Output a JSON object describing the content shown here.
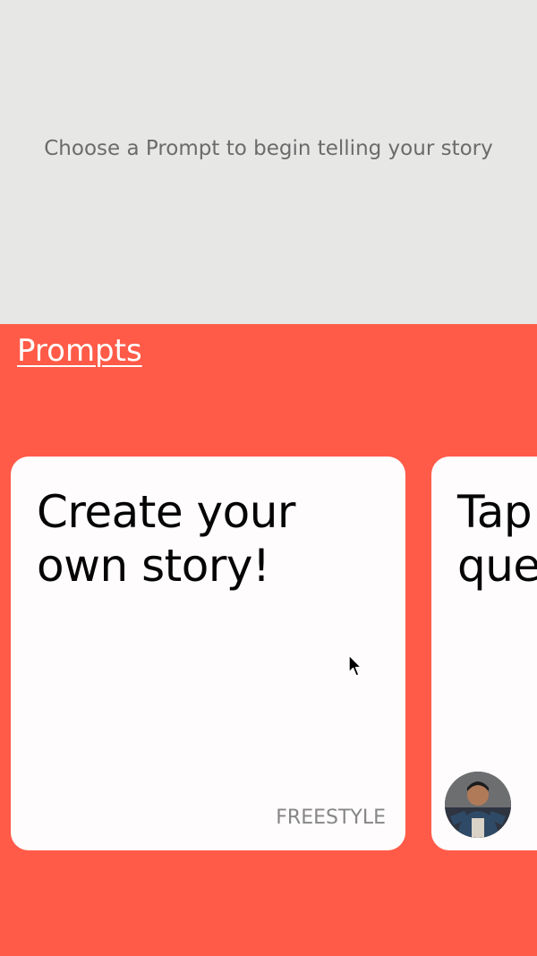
{
  "top": {
    "hint": "Choose a Prompt to begin telling your story"
  },
  "prompts": {
    "heading": "Prompts",
    "cards": [
      {
        "title": "Create your own story!",
        "tag": "FREESTYLE"
      },
      {
        "title": "Tap a question"
      }
    ]
  },
  "colors": {
    "panel_background": "#ff5b48",
    "top_background": "#e7e8e6",
    "card_background": "#fefcfd",
    "tag_text": "#868686"
  },
  "icons": {
    "avatar": "avatar",
    "cursor": "mouse-pointer-icon"
  }
}
